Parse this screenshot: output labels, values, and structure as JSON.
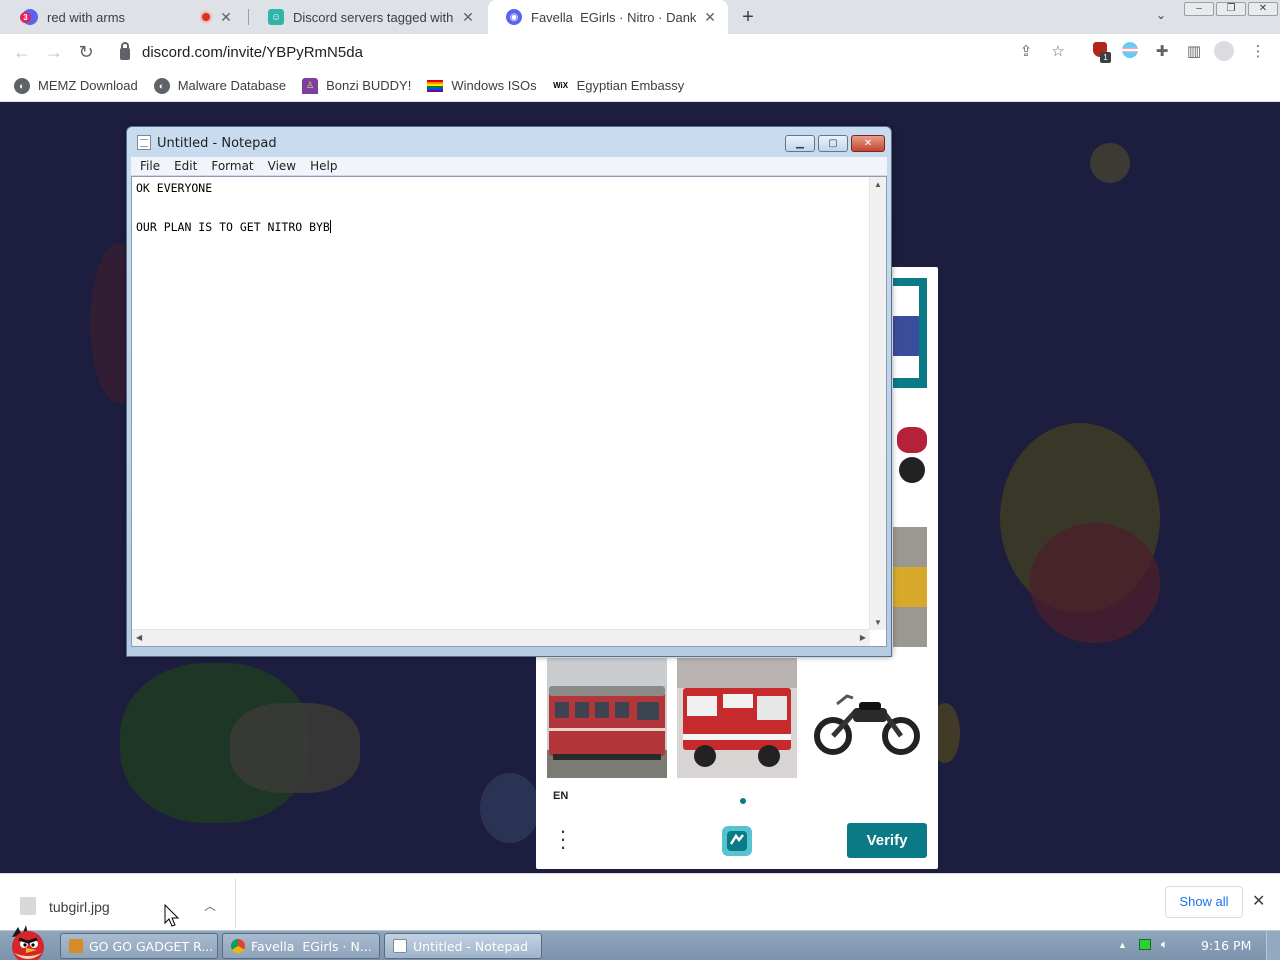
{
  "browser": {
    "tabs": [
      {
        "title": "red with arms",
        "active": false,
        "badge": "3"
      },
      {
        "title": "Discord servers tagged with e",
        "active": false
      },
      {
        "title": "Favella ⁣ EGirls · Nitro · Dank",
        "active": true
      }
    ],
    "url": "discord.com/invite/YBPyRmN5da",
    "extension_badge": "1",
    "bookmarks": [
      {
        "label": "MEMZ Download",
        "icon": "globe-icon"
      },
      {
        "label": "Malware Database",
        "icon": "globe-icon"
      },
      {
        "label": "Bonzi BUDDY!",
        "icon": "bonzi-icon"
      },
      {
        "label": "Windows ISOs",
        "icon": "rainbow-flag-icon"
      },
      {
        "label": "Egyptian Embassy",
        "icon": "wix-icon",
        "icon_text": "WiX"
      }
    ]
  },
  "notepad": {
    "title": "Untitled - Notepad",
    "menu": [
      "File",
      "Edit",
      "Format",
      "View",
      "Help"
    ],
    "text": "OK EVERYONE\n\nOUR PLAN IS TO GET NITRO BYB"
  },
  "captcha": {
    "language": "EN",
    "verify_label": "Verify",
    "tiles": [
      "train",
      "fire-truck",
      "motorcycle"
    ],
    "accent": "#0a7a86"
  },
  "downloads": {
    "file_name": "tubgirl.jpg",
    "show_all_label": "Show all"
  },
  "taskbar": {
    "tasks": [
      {
        "label": "GO GO GADGET R...",
        "icon": "archive-icon"
      },
      {
        "label": "Favella ⁣ EGirls · N...",
        "icon": "chrome-icon"
      },
      {
        "label": "Untitled - Notepad",
        "icon": "notepad-icon"
      }
    ],
    "clock": "9:16 PM"
  }
}
